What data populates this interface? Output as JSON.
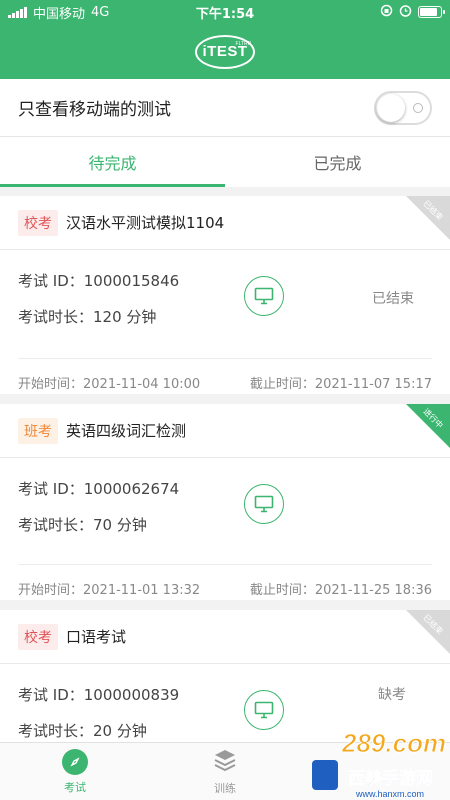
{
  "status_bar": {
    "carrier": "中国移动",
    "network": "4G",
    "time": "下午1:54"
  },
  "header": {
    "logo_text": "iTEST",
    "logo_sub": "FLTRP"
  },
  "filter": {
    "label": "只查看移动端的测试",
    "enabled": false
  },
  "tabs": [
    {
      "label": "待完成",
      "active": true
    },
    {
      "label": "已完成",
      "active": false
    }
  ],
  "exams": [
    {
      "tag": "校考",
      "title": "汉语水平测试模拟1104",
      "corner": "已结束",
      "id_text": "考试 ID：1000015846",
      "duration_text": "考试时长：120 分钟",
      "status": "已结束",
      "start": "开始时间：2021-11-04 10:00",
      "end": "截止时间：2021-11-07 15:17"
    },
    {
      "tag": "班考",
      "title": "英语四级词汇检测",
      "corner": "进行中",
      "id_text": "考试 ID：1000062674",
      "duration_text": "考试时长：70 分钟",
      "status": "",
      "start": "开始时间：2021-11-01 13:32",
      "end": "截止时间：2021-11-25 18:36"
    },
    {
      "tag": "校考",
      "title": "口语考试",
      "corner": "已结束",
      "id_text": "考试 ID：1000000839",
      "duration_text": "考试时长：20 分钟",
      "status": "缺考",
      "start": "",
      "end": ""
    }
  ],
  "tabbar": [
    {
      "label": "考试",
      "icon": "compass-icon",
      "active": true
    },
    {
      "label": "训练",
      "icon": "layers-icon",
      "active": false
    }
  ],
  "watermark": {
    "line1": "289.com",
    "line2": "西美手游网",
    "url": "www.hanxm.com"
  },
  "colors": {
    "primary": "#3bb56f",
    "school_tag": "#e0555a",
    "class_tag": "#ef8a3b"
  }
}
